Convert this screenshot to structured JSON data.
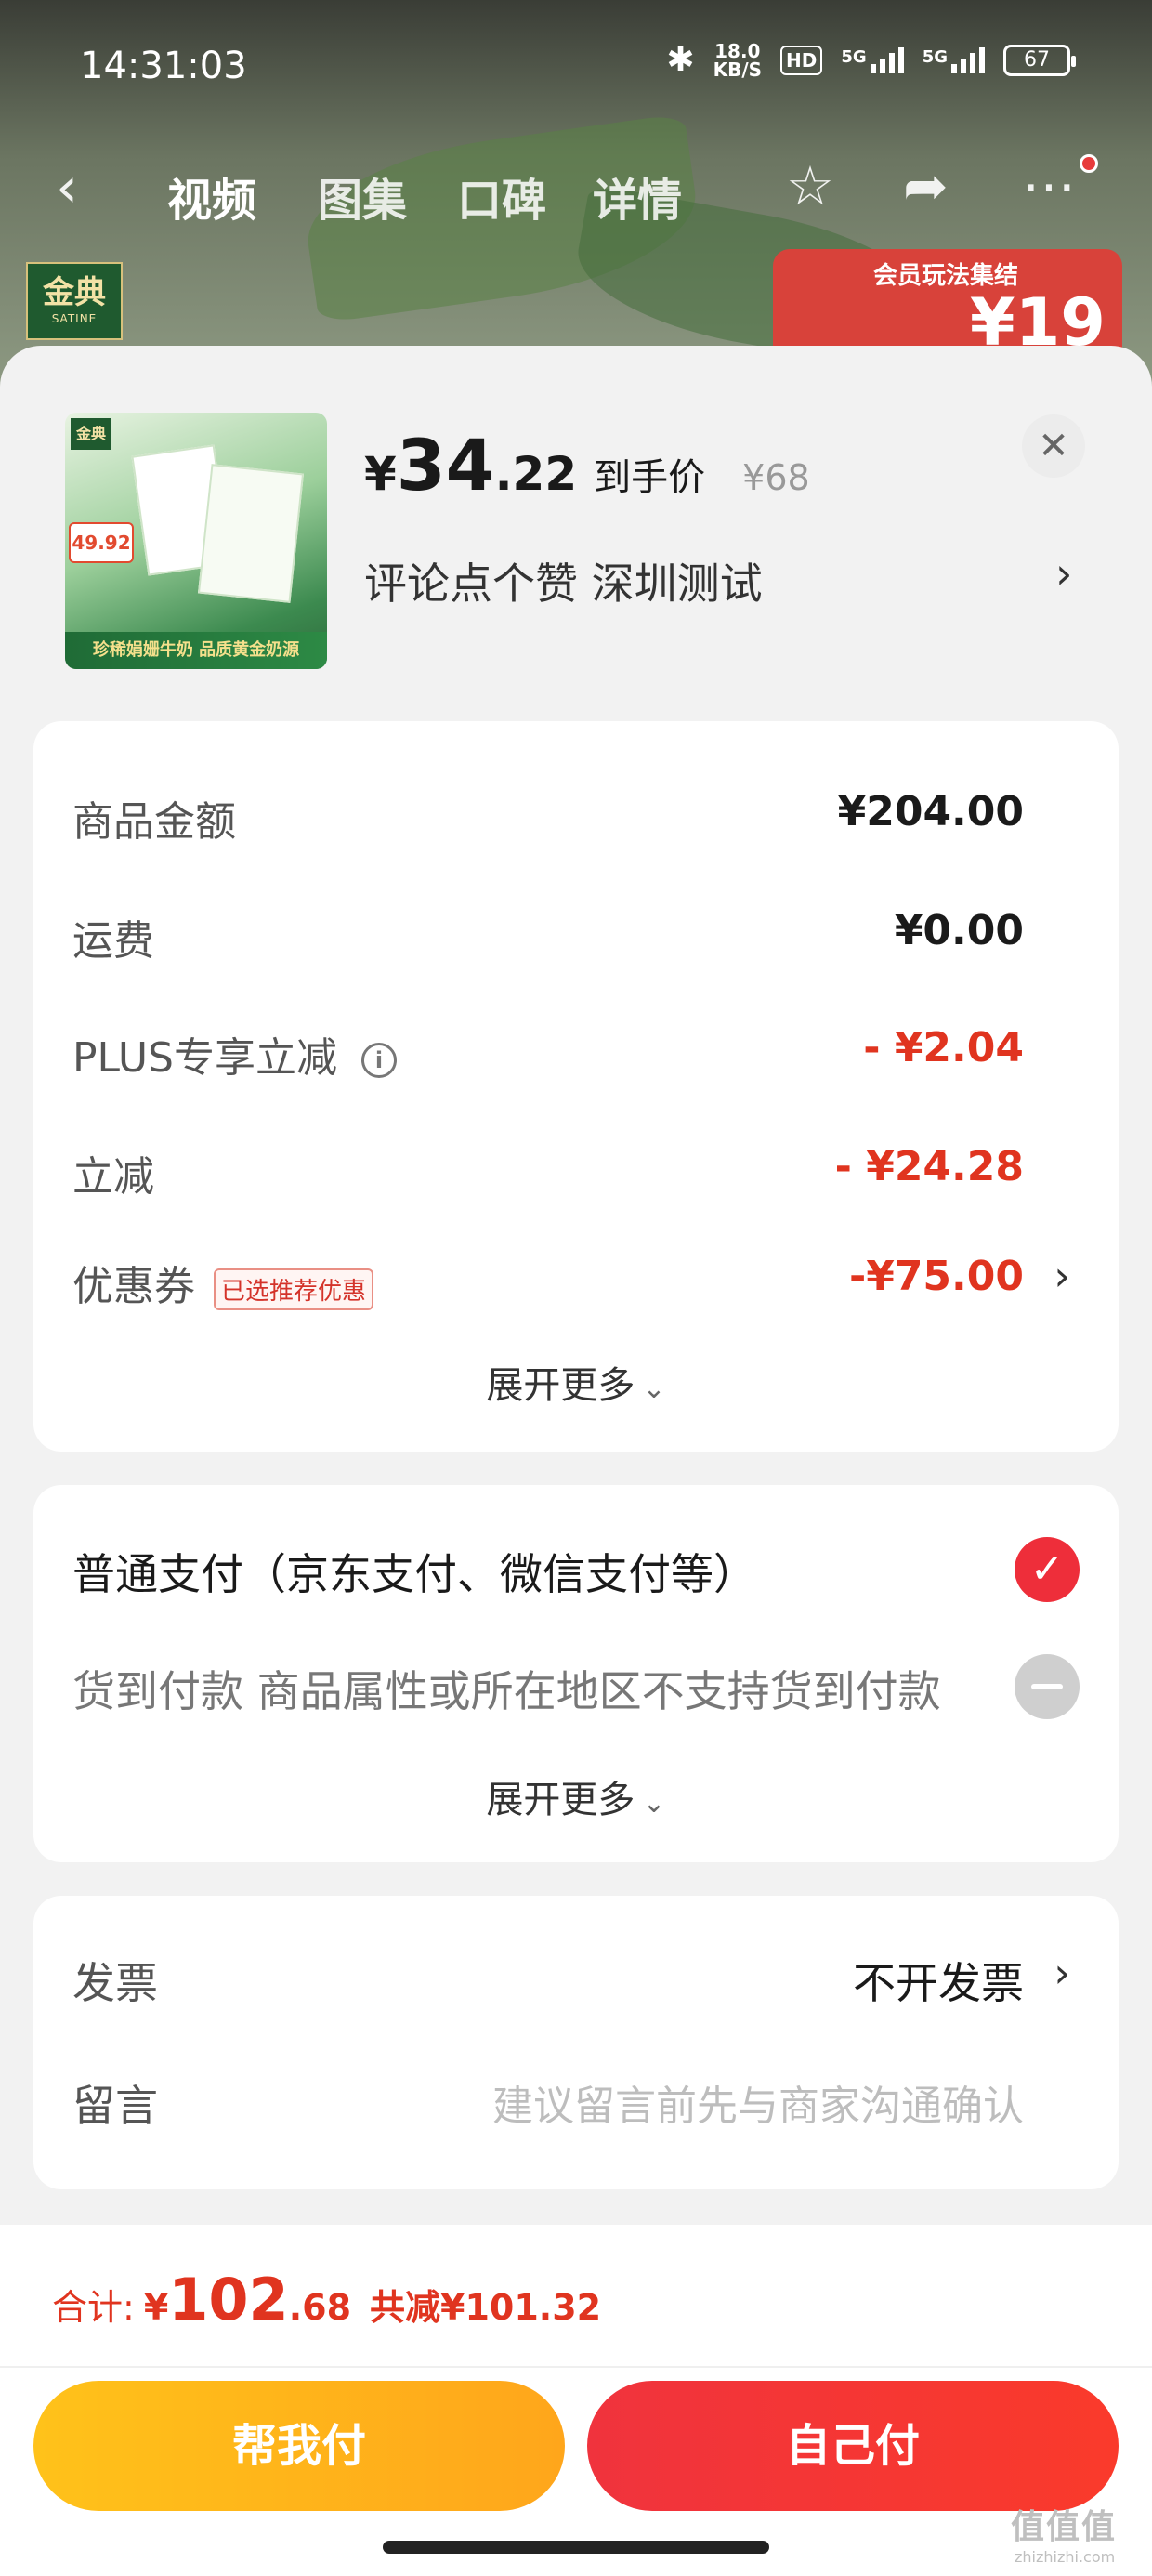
{
  "status_bar": {
    "time": "14:31:03",
    "speed_top": "18.0",
    "speed_unit": "KB/S",
    "hd": "HD",
    "sim1": "5G",
    "sim2": "5G",
    "battery": "67"
  },
  "nav": {
    "tabs": [
      "视频",
      "图集",
      "口碑",
      "详情"
    ],
    "active_tab": "视频"
  },
  "background": {
    "brand_cn": "金典",
    "brand_en": "SATINE",
    "promo_title": "会员玩法集结",
    "promo_value": "¥19"
  },
  "product": {
    "price_currency": "¥",
    "price_int": "34",
    "price_dec": ".22",
    "price_label": "到手价",
    "original_price": "¥68",
    "subtitle": "评论点个赞  深圳测试",
    "image": {
      "logo": "金典",
      "tag": "49.92",
      "band_text": "珍稀娟姗牛奶 品质黄金奶源"
    }
  },
  "summary": {
    "rows": [
      {
        "label": "商品金额",
        "value": "¥204.00"
      },
      {
        "label": "运费",
        "value": "¥0.00"
      },
      {
        "label": "PLUS专享立减",
        "value": "- ¥2.04"
      },
      {
        "label": "立减",
        "value": "- ¥24.28"
      },
      {
        "label": "优惠券",
        "value": "-¥75.00",
        "badge": "已选推荐优惠"
      }
    ],
    "more_label": "展开更多"
  },
  "payment": {
    "options": [
      {
        "label": "普通支付（京东支付、微信支付等）",
        "selected": true
      },
      {
        "label": "货到付款 商品属性或所在地区不支持货到付款",
        "selected": false
      }
    ],
    "more_label": "展开更多"
  },
  "extras": {
    "invoice_label": "发票",
    "invoice_value": "不开发票",
    "note_label": "留言",
    "note_placeholder": "建议留言前先与商家沟通确认"
  },
  "footer": {
    "total_label": "合计:",
    "total_currency": "¥",
    "total_int": "102",
    "total_dec": ".68",
    "saved": "共减¥101.32",
    "help_pay": "帮我付",
    "self_pay": "自己付"
  },
  "watermark": {
    "text": "值值值",
    "url": "zhizhizhi.com"
  },
  "colors": {
    "accent_red": "#e0341f",
    "help_yellow": "#ffb41b",
    "pay_red": "#f0333d"
  }
}
